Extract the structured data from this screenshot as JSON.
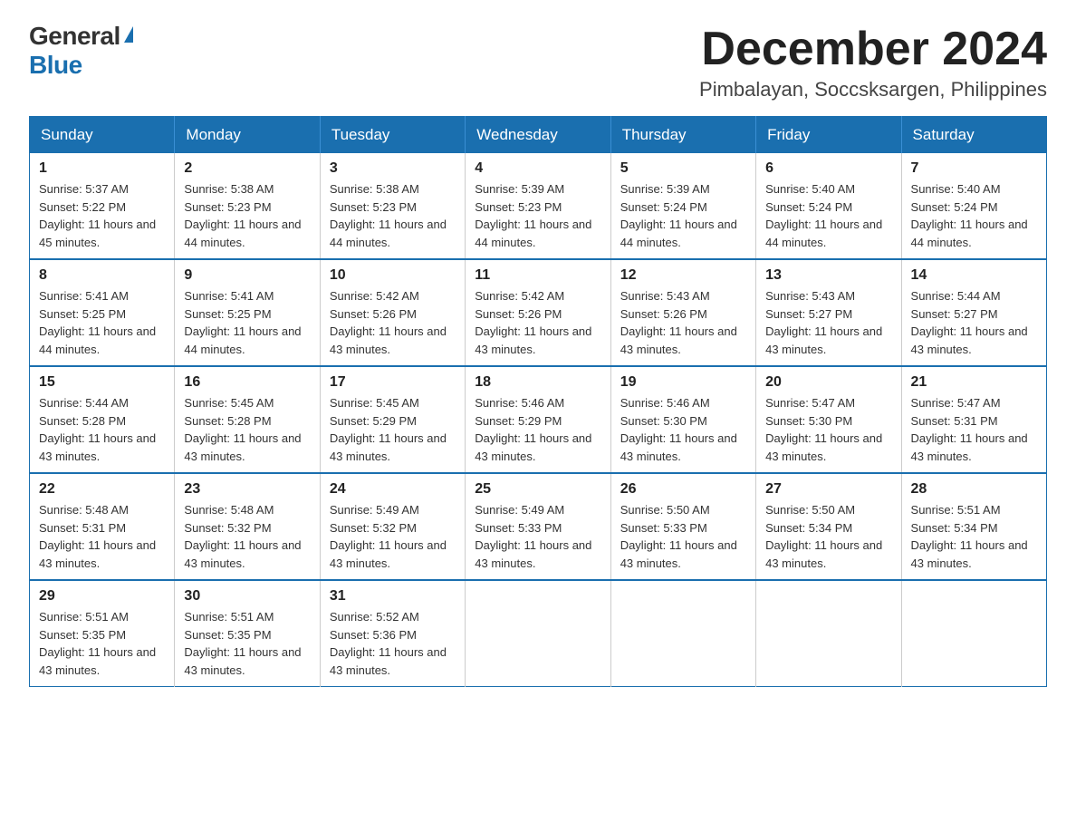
{
  "logo": {
    "general": "General",
    "blue": "Blue"
  },
  "header": {
    "month": "December 2024",
    "location": "Pimbalayan, Soccsksargen, Philippines"
  },
  "weekdays": [
    "Sunday",
    "Monday",
    "Tuesday",
    "Wednesday",
    "Thursday",
    "Friday",
    "Saturday"
  ],
  "weeks": [
    [
      {
        "day": "1",
        "sunrise": "5:37 AM",
        "sunset": "5:22 PM",
        "daylight": "11 hours and 45 minutes."
      },
      {
        "day": "2",
        "sunrise": "5:38 AM",
        "sunset": "5:23 PM",
        "daylight": "11 hours and 44 minutes."
      },
      {
        "day": "3",
        "sunrise": "5:38 AM",
        "sunset": "5:23 PM",
        "daylight": "11 hours and 44 minutes."
      },
      {
        "day": "4",
        "sunrise": "5:39 AM",
        "sunset": "5:23 PM",
        "daylight": "11 hours and 44 minutes."
      },
      {
        "day": "5",
        "sunrise": "5:39 AM",
        "sunset": "5:24 PM",
        "daylight": "11 hours and 44 minutes."
      },
      {
        "day": "6",
        "sunrise": "5:40 AM",
        "sunset": "5:24 PM",
        "daylight": "11 hours and 44 minutes."
      },
      {
        "day": "7",
        "sunrise": "5:40 AM",
        "sunset": "5:24 PM",
        "daylight": "11 hours and 44 minutes."
      }
    ],
    [
      {
        "day": "8",
        "sunrise": "5:41 AM",
        "sunset": "5:25 PM",
        "daylight": "11 hours and 44 minutes."
      },
      {
        "day": "9",
        "sunrise": "5:41 AM",
        "sunset": "5:25 PM",
        "daylight": "11 hours and 44 minutes."
      },
      {
        "day": "10",
        "sunrise": "5:42 AM",
        "sunset": "5:26 PM",
        "daylight": "11 hours and 43 minutes."
      },
      {
        "day": "11",
        "sunrise": "5:42 AM",
        "sunset": "5:26 PM",
        "daylight": "11 hours and 43 minutes."
      },
      {
        "day": "12",
        "sunrise": "5:43 AM",
        "sunset": "5:26 PM",
        "daylight": "11 hours and 43 minutes."
      },
      {
        "day": "13",
        "sunrise": "5:43 AM",
        "sunset": "5:27 PM",
        "daylight": "11 hours and 43 minutes."
      },
      {
        "day": "14",
        "sunrise": "5:44 AM",
        "sunset": "5:27 PM",
        "daylight": "11 hours and 43 minutes."
      }
    ],
    [
      {
        "day": "15",
        "sunrise": "5:44 AM",
        "sunset": "5:28 PM",
        "daylight": "11 hours and 43 minutes."
      },
      {
        "day": "16",
        "sunrise": "5:45 AM",
        "sunset": "5:28 PM",
        "daylight": "11 hours and 43 minutes."
      },
      {
        "day": "17",
        "sunrise": "5:45 AM",
        "sunset": "5:29 PM",
        "daylight": "11 hours and 43 minutes."
      },
      {
        "day": "18",
        "sunrise": "5:46 AM",
        "sunset": "5:29 PM",
        "daylight": "11 hours and 43 minutes."
      },
      {
        "day": "19",
        "sunrise": "5:46 AM",
        "sunset": "5:30 PM",
        "daylight": "11 hours and 43 minutes."
      },
      {
        "day": "20",
        "sunrise": "5:47 AM",
        "sunset": "5:30 PM",
        "daylight": "11 hours and 43 minutes."
      },
      {
        "day": "21",
        "sunrise": "5:47 AM",
        "sunset": "5:31 PM",
        "daylight": "11 hours and 43 minutes."
      }
    ],
    [
      {
        "day": "22",
        "sunrise": "5:48 AM",
        "sunset": "5:31 PM",
        "daylight": "11 hours and 43 minutes."
      },
      {
        "day": "23",
        "sunrise": "5:48 AM",
        "sunset": "5:32 PM",
        "daylight": "11 hours and 43 minutes."
      },
      {
        "day": "24",
        "sunrise": "5:49 AM",
        "sunset": "5:32 PM",
        "daylight": "11 hours and 43 minutes."
      },
      {
        "day": "25",
        "sunrise": "5:49 AM",
        "sunset": "5:33 PM",
        "daylight": "11 hours and 43 minutes."
      },
      {
        "day": "26",
        "sunrise": "5:50 AM",
        "sunset": "5:33 PM",
        "daylight": "11 hours and 43 minutes."
      },
      {
        "day": "27",
        "sunrise": "5:50 AM",
        "sunset": "5:34 PM",
        "daylight": "11 hours and 43 minutes."
      },
      {
        "day": "28",
        "sunrise": "5:51 AM",
        "sunset": "5:34 PM",
        "daylight": "11 hours and 43 minutes."
      }
    ],
    [
      {
        "day": "29",
        "sunrise": "5:51 AM",
        "sunset": "5:35 PM",
        "daylight": "11 hours and 43 minutes."
      },
      {
        "day": "30",
        "sunrise": "5:51 AM",
        "sunset": "5:35 PM",
        "daylight": "11 hours and 43 minutes."
      },
      {
        "day": "31",
        "sunrise": "5:52 AM",
        "sunset": "5:36 PM",
        "daylight": "11 hours and 43 minutes."
      },
      null,
      null,
      null,
      null
    ]
  ]
}
